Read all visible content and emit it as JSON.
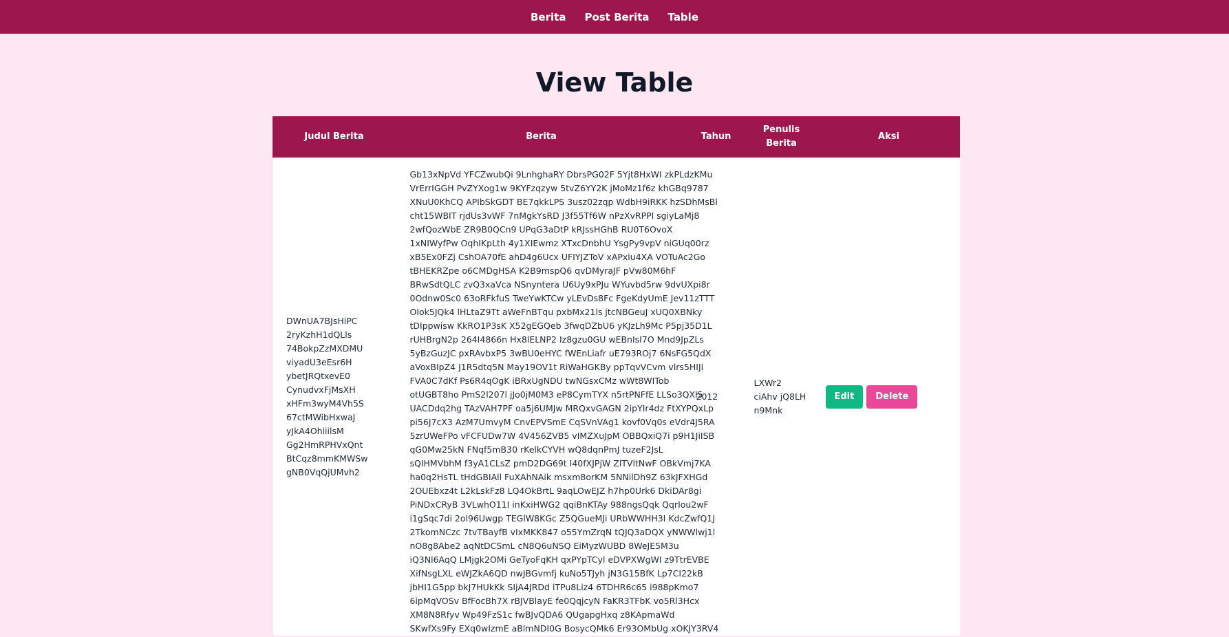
{
  "nav": {
    "items": [
      "Berita",
      "Post Berita",
      "Table"
    ]
  },
  "page": {
    "title": "View Table"
  },
  "table": {
    "headers": {
      "judul": "Judul Berita",
      "berita": "Berita",
      "tahun": "Tahun",
      "penulis_line1": "Penulis",
      "penulis_line2": "Berita",
      "aksi": "Aksi"
    },
    "row": {
      "judul_lines": [
        "DWnUA7BJsHiPC",
        "2ryKzhH1dQLls",
        "74BokpZzMXDMU",
        "viyadU3eEsr6H",
        "ybetJRQtxevE0",
        "CynudvxFjMsXH",
        "xHFm3wyM4Vh5S",
        "67ctMWibHxwaJ",
        "yJkA4OhiiilsM",
        "Gg2HmRPHVxQnt",
        "BtCqz8mmKMWSw",
        "gNB0VqQjUMvh2"
      ],
      "berita_lines": [
        "Gb13xNpVd YFCZwubQi 9LnhghaRY DbrsPG02F 5Yjt8HxWI zkPLdzKMu",
        "VrErrIGGH PvZYXog1w 9KYFzqzyw 5tvZ6YY2K jMoMz1f6z khGBq9787",
        "XNuU0KhCQ APIbSkGDT BE7qkkLPS 3usz02zqp WdbH9iRKK hzSDhMsBl",
        "cht15WBIT rjdUs3vWF 7nMgkYsRD J3f55Tf6W nPzXvRPPl sgiyLaMj8",
        "2wfQozWbE ZR9B0QCn9 UPqG3aDtP kRJssHGhB RU0T6OvoX",
        "1xNIWyfPw OqhIKpLth 4y1XIEwmz XTxcDnbhU YsgPy9vpV niGUq00rz",
        "xB5Ex0FZj CshOA70fE ahD4g6Ucx UFIYJZToV xAPxiu4XA VOTuAc2Go",
        "tBHEKRZpe o6CMDgHSA K2B9mspQ6 qvDMyraJF pVw80M6hF",
        "BRwSdtQLC zvQ3xaVca NSnyntera U6Uy9xPJu WYuvbd5rw 9dvUXpi8r",
        "0Odnw0Sc0 63oRFkfuS TweYwKTCw yLEvDs8Fc FgeKdyUmE Jev11zTTT",
        "OIok5JQk4 lHLtaZ9Tt aWeFnBTqu pxbMx21ls jtcNBGeuJ xUQ0XBNky",
        "tDIppwisw KkRO1P3sK X52gEGQeb 3fwqDZbU6 yKJzLh9Mc P5pj35D1L",
        "rUHBrgN2p 264I4866n Hx8lELNP2 Iz8gzu0GU wEBnIsI7O Mnd9JpZLs",
        "5yBzGuzJC pxRAvbxP5 3wBU0eHYC fWEnLiafr uE793ROj7 6NsFG5QdX",
        "aVoxBIpZ4 J1R5dtq5N May19OV1t RiWaHGKBy ppTqvVCvm vlrs5HIJi",
        "FVA0C7dKf Ps6R4qOgK iBRxUgNDU twNGsxCMz wWt8WITob",
        "otUGBT8ho PmS2l207l jJo0jM0M3 eP8CymTYX n5rtPNFfE LLSo3QXl5",
        "UACDdq2hg TAzVAH7PF oa5j6UMJw MRQxvGAGN 2ipYIr4dz FtXYPQxLp",
        "pi56J7cX3 AzM7UmvyM CnvEPVSmE CqSVnVAg1 kovf0Vq0s eVdr4J5RA",
        "5zrUWeFPo vFCFUDw7W 4V456ZVB5 vIMZXuJpM OBBQxiQ7i p9H1JiISB",
        "qG0Mw25kN FNqf5mB30 rKelkCYVH wQ8dqnPmJ tuzeF2JsL",
        "sQIHMVbhM f3yA1CLsZ pmD2DG69t I40fXJPjW ZlTVltNwF OBkVmj7KA",
        "ha0q2HsTL tHdGBIAll FuXAhNAik msxm8orKM 5NNilDh9Z 63kJFXHGd",
        "2OUEbxz4t L2kLskFz8 LQ4OkBrtL 9aqLOwEJZ h7hp0Urk6 DkiDAr8gi",
        "PiNDxCRyB 3VLwhO11I inKxiHWG2 qqiBnKTAy 988ngsQqk QqrIou2wF",
        "i1gSqc7di 2ol96Uwgp TEGlW8KGc Z5QGueMJi URbWWHH3I KdcZwfQ1J",
        "2TkomNCzc 7tvTBayfB vIxMKK847 o55YmZrqN tQJQ3aDQX yNWWlwj1l",
        "nO8g8Abe2 aqNtDCSmL cN8Q6uNSQ EiMyzWUBD 8WeJE5M3u",
        "iQ3Nl6AqQ LMjgk2OMi GeTyoFqKH qxPYpTCyl eDVPXWgWI z9TtrEVBE",
        "XifNsgLXL eWJZkA6QD nwJBGvmfj kuNo5TJyh jN3G15BfK Lp7CI22kB",
        "jbHI1G5pp bkJ7HUkKk SIjA4JRDd iTPu8Liz4 6TDHR6c65 i988pKmo7",
        "6ipMqVOSv BfFocBh7X rBJVBlayE fe0QqjcyN FaKR3TFbK vo5Rl3Hcx",
        "XM8N8Rfyv Wp49FzS1c fwBJvQDA6 QUgapgHxq z8KApmaWd",
        "SKwfXs9Fy EXq0wIzmE aBlmNDI0G BosycQMk6 Er93OMbUg xOKJY3RV4"
      ],
      "tahun": "2012",
      "penulis_lines": [
        "LXWr2",
        "ciAhv jQ8LH",
        "n9Mnk"
      ],
      "edit_label": "Edit",
      "delete_label": "Delete"
    }
  },
  "colors": {
    "navbar": "#9d174d",
    "background": "#fce7f3",
    "edit_button": "#10b981",
    "delete_button": "#ec4899"
  }
}
